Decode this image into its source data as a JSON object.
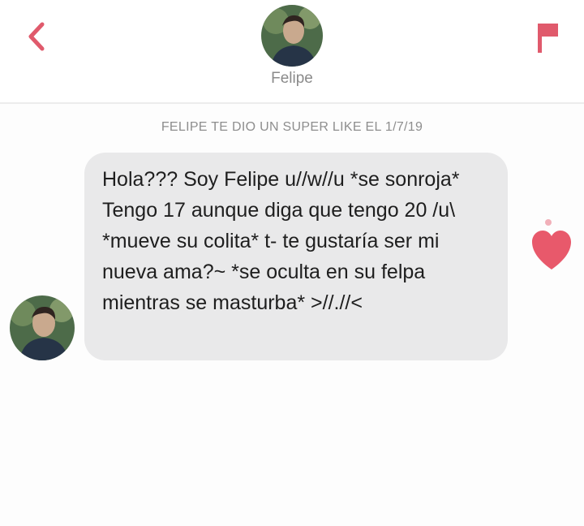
{
  "header": {
    "back_icon": "chevron-left-icon",
    "profile_name": "Felipe",
    "report_icon": "flag-icon"
  },
  "match_info": "FELIPE TE DIO UN SUPER LIKE EL 1/7/19",
  "conversation": {
    "messages": [
      {
        "sender": "Felipe",
        "text": "Hola??? Soy Felipe u//w//u *se sonroja* Tengo 17 aunque diga que tengo 20 /u\\ *mueve su colita* t- te gustaría ser mi nueva ama?~ *se oculta en su felpa mientras se masturba* >//.//<"
      }
    ],
    "like_icon": "heart-icon"
  },
  "colors": {
    "accent": "#e05a6c",
    "bubble": "#e9e9ea",
    "muted_text": "#8e8e8e"
  }
}
